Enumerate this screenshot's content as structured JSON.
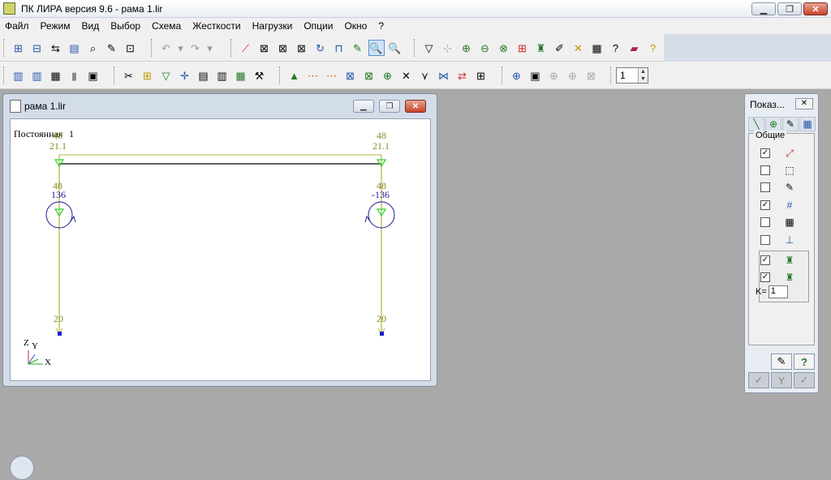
{
  "window": {
    "title": "ПК ЛИРА  версия 9.6 - рама 1.lir",
    "min_label": "▁",
    "max_label": "❐",
    "close_label": "✕"
  },
  "menu": [
    "Файл",
    "Режим",
    "Вид",
    "Выбор",
    "Схема",
    "Жесткости",
    "Нагрузки",
    "Опции",
    "Окно",
    "?"
  ],
  "toolbar1": {
    "group1": [
      "⊞",
      "⊟",
      "⇆",
      "▤",
      "⌕",
      "✎",
      "⊡"
    ],
    "group2": [
      "↶",
      "▾",
      "↷",
      "▾"
    ],
    "group3": [
      "⟋",
      "⊠",
      "⊠",
      "⊠",
      "↻",
      "⊓",
      "✎",
      "🔍",
      "🔍"
    ],
    "group4": [
      "▽",
      "⊹",
      "⊕",
      "⊖",
      "⊗",
      "⊞",
      "♜",
      "✐",
      "✕",
      "▦",
      "?",
      "▰",
      "?"
    ]
  },
  "toolbar2": {
    "group1": [
      "▥",
      "▥",
      "▦",
      "▮",
      "▣"
    ],
    "group2": [
      "✂",
      "⊞",
      "▽",
      "✛",
      "▤",
      "▥",
      "▦",
      "⚒"
    ],
    "group3": [
      "▲",
      "⋯",
      "⋯",
      "⊠",
      "⊠",
      "⊕",
      "✕",
      "⋎",
      "⋈",
      "⇄",
      "⊞"
    ],
    "group4": [
      "⊕",
      "▣",
      "⊕",
      "⊕",
      "⊠"
    ],
    "spin_value": "1",
    "spin_up": "▲",
    "spin_down": "▼"
  },
  "document": {
    "title": "рама 1.lir",
    "load_case_label": "Постоянная",
    "load_case_number": "1",
    "labels": {
      "left_top": "48",
      "left_top2": "21.1",
      "right_top": "48",
      "right_top2": "21.1",
      "left_mid": "48",
      "left_mid2": "136",
      "right_mid": "48",
      "right_mid2": "-136",
      "left_bottom": "20",
      "right_bottom": "20"
    },
    "axes": {
      "z": "Z",
      "y": "Y",
      "x": "X"
    }
  },
  "panel": {
    "title": "Показ...",
    "close_label": "✕",
    "group_label": "Общие",
    "tab_icons": [
      "╲",
      "⊕",
      "✎",
      "▦"
    ],
    "rows": [
      {
        "checked": true,
        "icon": "⤢"
      },
      {
        "checked": false,
        "icon": "⬚"
      },
      {
        "checked": false,
        "icon": "✎"
      },
      {
        "checked": true,
        "icon": "#"
      },
      {
        "checked": false,
        "icon": "▦"
      },
      {
        "checked": false,
        "icon": "⊥"
      }
    ],
    "sub_rows": [
      {
        "checked": true,
        "icon": "♜"
      },
      {
        "checked": true,
        "icon": "♜"
      }
    ],
    "check_mark": "✓",
    "unchecked_mark": "",
    "k_label": "K=",
    "k_value": "1",
    "bottom_buttons": [
      "✎",
      "?",
      "✓",
      "Y",
      "✓"
    ]
  },
  "colors": {
    "olive": "#8a8a2a",
    "frame_line": "#b3b33c",
    "beam": "#000000",
    "support": "#2bd12b",
    "moment": "#1a1a9a",
    "node": "#1a1ad1"
  }
}
